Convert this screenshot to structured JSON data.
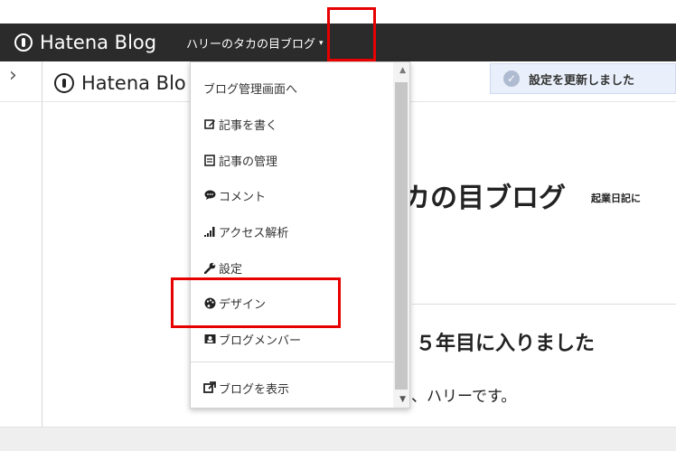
{
  "topbar": {
    "brand": "Hatena Blog",
    "blog_name": "ハリーのタカの目ブログ",
    "caret": "▾"
  },
  "subbar": {
    "expand_icon": "›",
    "brand": "Hatena Blo",
    "notice": "設定を更新しました"
  },
  "content": {
    "blog_title": "カの目ブログ",
    "blog_tagline": "起業日記に",
    "post_title": "５年目に入りました",
    "post_body": "、ハリーです。"
  },
  "menu": {
    "items": [
      {
        "label": "ブログ管理画面へ",
        "icon": ""
      },
      {
        "label": "記事を書く",
        "icon": "edit-icon"
      },
      {
        "label": "記事の管理",
        "icon": "document-icon"
      },
      {
        "label": "コメント",
        "icon": "comment-icon"
      },
      {
        "label": "アクセス解析",
        "icon": "signal-icon"
      },
      {
        "label": "設定",
        "icon": "wrench-icon"
      },
      {
        "label": "デザイン",
        "icon": "palette-icon"
      },
      {
        "label": "ブログメンバー",
        "icon": "members-icon"
      },
      {
        "label": "ブログを表示",
        "icon": "external-link-icon"
      }
    ]
  },
  "highlight_color": "#e60000"
}
